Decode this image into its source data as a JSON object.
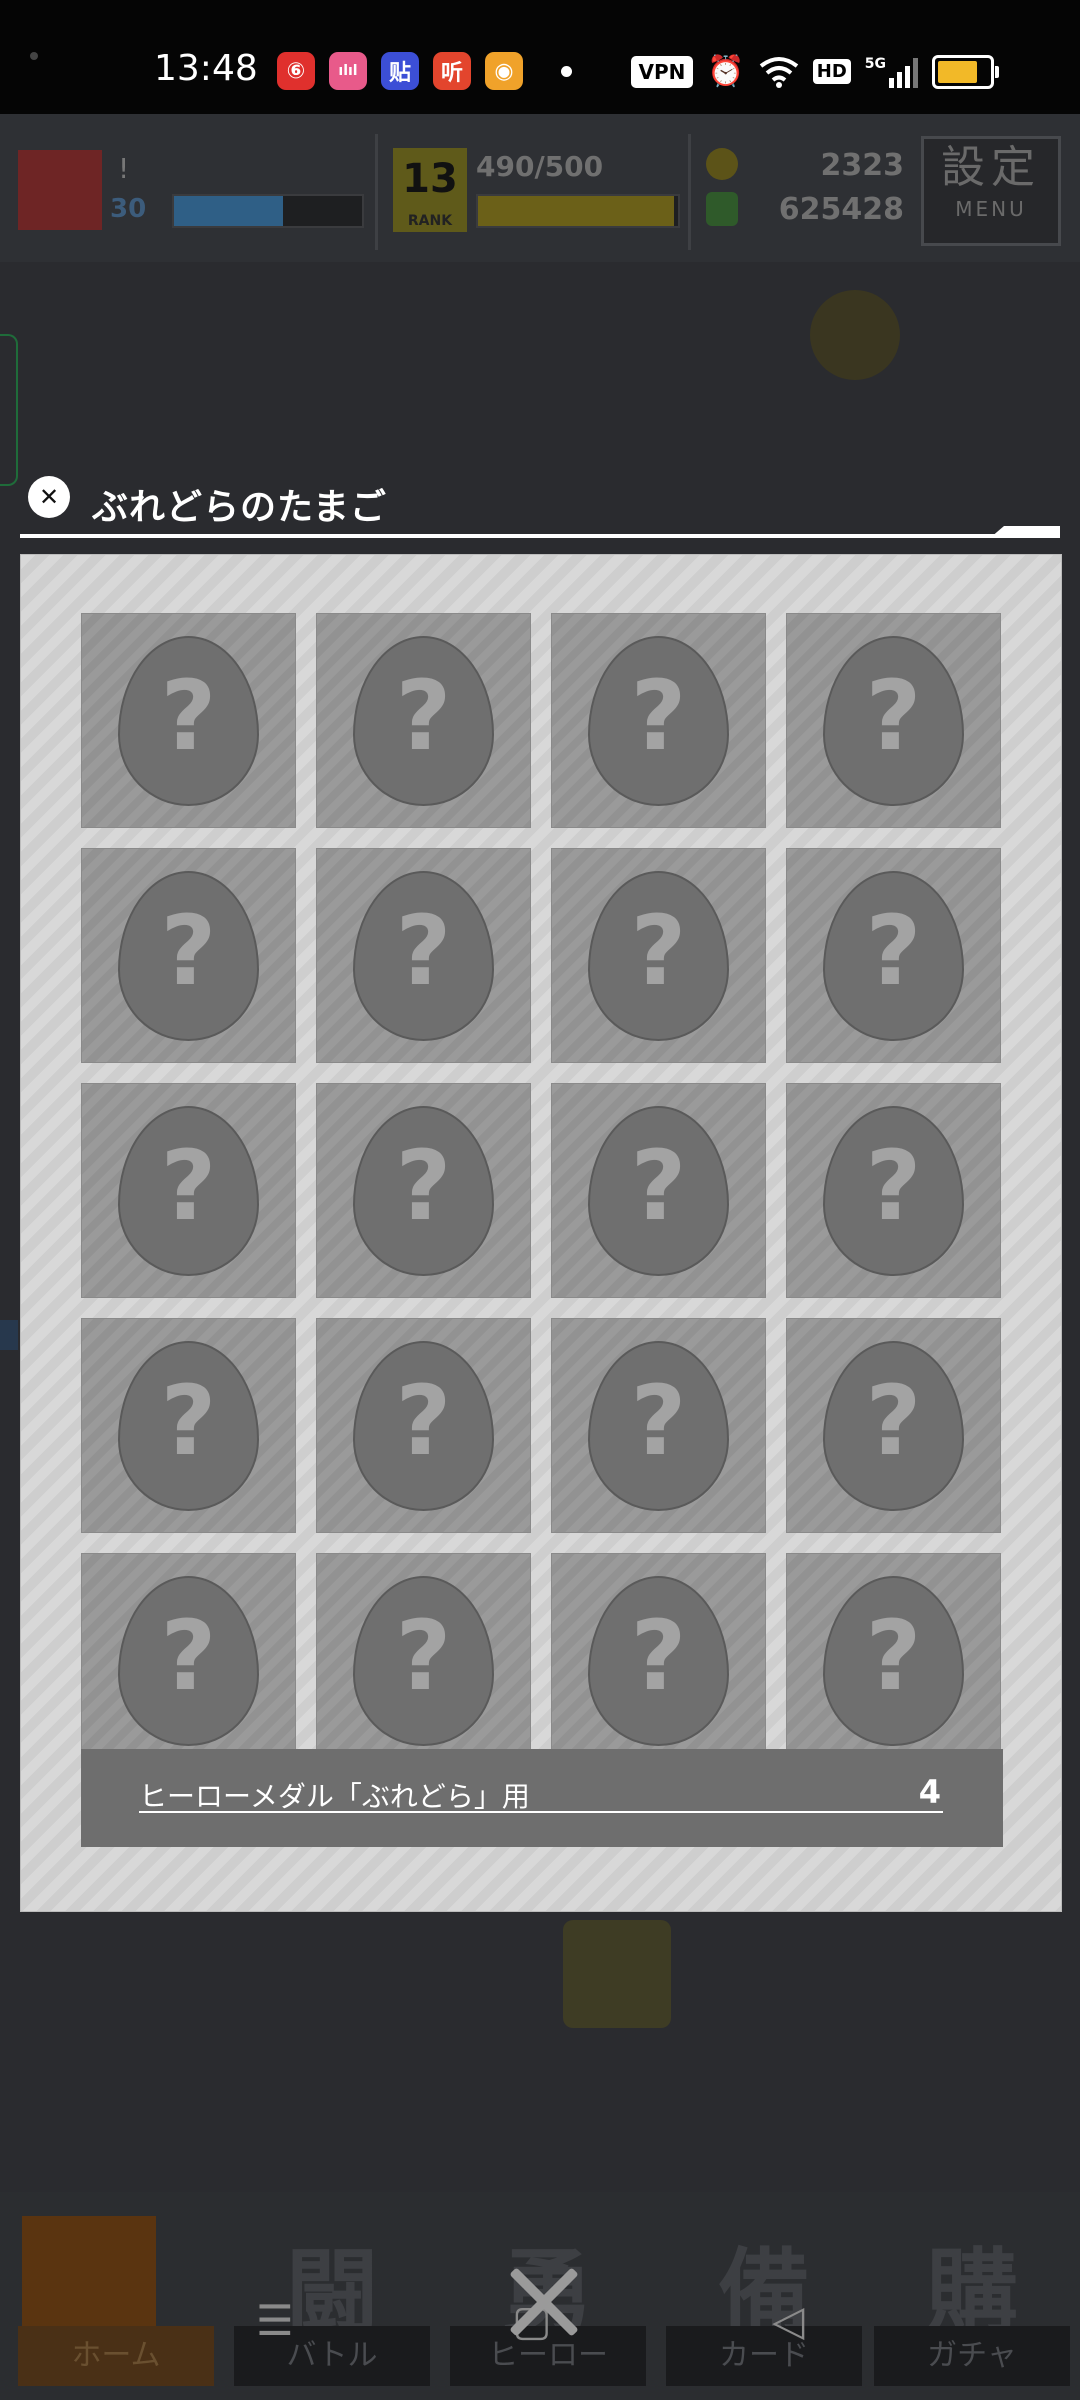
{
  "status_bar": {
    "time": "13:48",
    "apps": [
      {
        "icon": "netease-music-icon",
        "glyph": "⑥",
        "color": "#e0302d"
      },
      {
        "icon": "bilibili-icon",
        "glyph": "ılıl",
        "color": "#e85a8a"
      },
      {
        "icon": "tieba-icon",
        "glyph": "贴",
        "color": "#3c4fd6"
      },
      {
        "icon": "ximalaya-icon",
        "glyph": "听",
        "color": "#e3452d"
      },
      {
        "icon": "weibo-icon",
        "glyph": "◉",
        "color": "#f0a22a"
      }
    ],
    "vpn": "VPN",
    "hd": "HD",
    "network": "5G"
  },
  "hud": {
    "player_name": "!",
    "level": "30",
    "rank_number": "13",
    "rank_label": "RANK",
    "exp": "490/500",
    "currency_gold": "2323",
    "currency_green": "625428",
    "menu_kanji": "設定",
    "menu_label": "MENU"
  },
  "dialog": {
    "title": "ぶれどらのたまご",
    "slot_symbol": "?",
    "footer_label": "ヒーローメダル「ぶれどら」用",
    "footer_count": "4"
  },
  "bottom_nav": [
    {
      "kanji": "",
      "label": "ホーム"
    },
    {
      "kanji": "闘",
      "label": "バトル"
    },
    {
      "kanji": "勇",
      "label": "ヒーロー"
    },
    {
      "kanji": "備",
      "label": "カード"
    },
    {
      "kanji": "購",
      "label": "ガチャ"
    }
  ],
  "colors": {
    "panel": "#d8d8d8",
    "slot": "#9a9a9a",
    "egg": "#6f6f6f",
    "footer_bar": "#6e6e6e",
    "battery": "#f2b928"
  }
}
